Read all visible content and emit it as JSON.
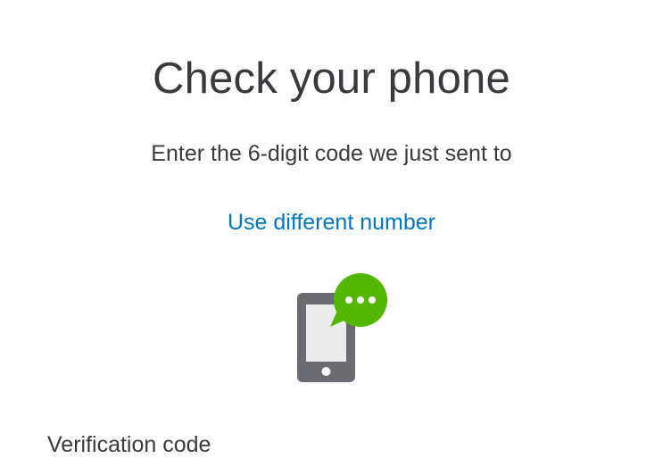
{
  "header": {
    "title": "Check your phone"
  },
  "instructions": {
    "text": "Enter the 6-digit code we just sent to"
  },
  "links": {
    "use_different_number": "Use different number"
  },
  "illustration": {
    "icon": "phone-message-icon",
    "colors": {
      "phone_body": "#6b6c72",
      "screen": "#ececec",
      "bubble": "#53b700",
      "dots": "#ffffff"
    }
  },
  "form": {
    "verification_label": "Verification code"
  },
  "colors": {
    "text": "#393a3d",
    "link": "#0077c5",
    "background": "#ffffff"
  }
}
